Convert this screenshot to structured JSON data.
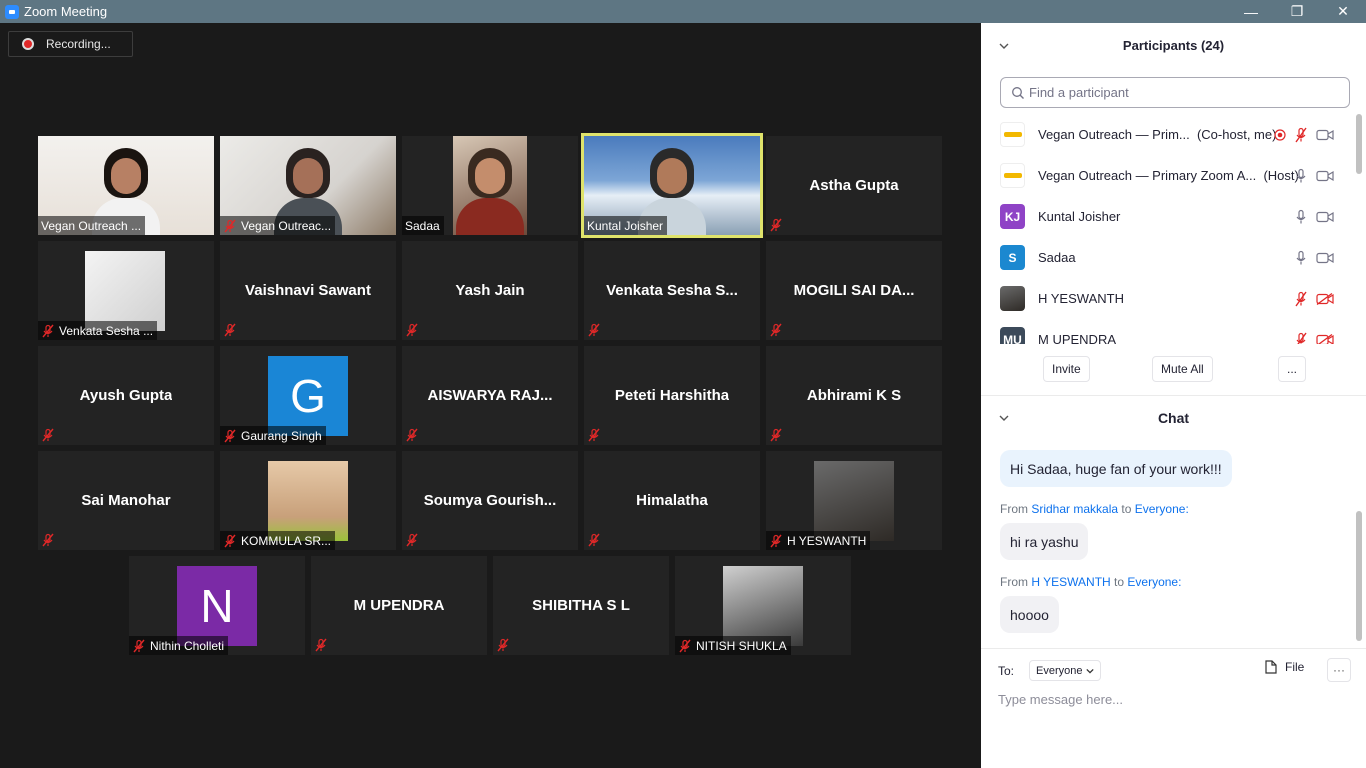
{
  "window": {
    "title": "Zoom Meeting",
    "minimize": "—",
    "restore": "❐",
    "close": "✕"
  },
  "recording": {
    "label": "Recording..."
  },
  "tiles": [
    {
      "label": "Vegan Outreach ...",
      "kind": "video",
      "muted": false
    },
    {
      "label": "Vegan Outreac...",
      "kind": "video",
      "muted": true
    },
    {
      "label": "Sadaa",
      "kind": "video",
      "muted": false
    },
    {
      "label": "Kuntal Joisher",
      "kind": "video",
      "muted": false,
      "active": true
    },
    {
      "name": "Astha Gupta",
      "kind": "name",
      "muted": true
    },
    {
      "label": "Venkata Sesha ...",
      "kind": "picture",
      "muted": true
    },
    {
      "name": "Vaishnavi Sawant",
      "kind": "name",
      "muted": true
    },
    {
      "name": "Yash Jain",
      "kind": "name",
      "muted": true
    },
    {
      "name": "Venkata  Sesha  S...",
      "kind": "name",
      "muted": true
    },
    {
      "name": "MOGILI SAI DA...",
      "kind": "name",
      "muted": true
    },
    {
      "name": "Ayush Gupta",
      "kind": "name",
      "muted": true
    },
    {
      "label": "Gaurang Singh",
      "kind": "avatar",
      "letter": "G",
      "color": "#1a86d6",
      "muted": true
    },
    {
      "name": "AISWARYA RAJ...",
      "kind": "name",
      "muted": true
    },
    {
      "name": "Peteti Harshitha",
      "kind": "name",
      "muted": true
    },
    {
      "name": "Abhirami K S",
      "kind": "name",
      "muted": true
    },
    {
      "name": "Sai Manohar",
      "kind": "name",
      "muted": true
    },
    {
      "label": "KOMMULA SR...",
      "kind": "picture",
      "muted": true
    },
    {
      "name": "Soumya  Gourish...",
      "kind": "name",
      "muted": true
    },
    {
      "name": "Himalatha",
      "kind": "name",
      "muted": true
    },
    {
      "label": "H YESWANTH",
      "kind": "picture",
      "muted": true
    },
    {
      "label": "Nithin Cholleti",
      "kind": "avatar",
      "letter": "N",
      "color": "#7b2aa6",
      "muted": true
    },
    {
      "name": "M UPENDRA",
      "kind": "name",
      "muted": true
    },
    {
      "name": "SHIBITHA S L",
      "kind": "name",
      "muted": true
    },
    {
      "label": "NITISH SHUKLA",
      "kind": "picture",
      "muted": true
    }
  ],
  "participants": {
    "title": "Participants (24)",
    "search_placeholder": "Find a participant",
    "items": [
      {
        "name": "Vegan Outreach — Prim...",
        "role": "(Co-host, me)",
        "avatar": "logo",
        "recording": true,
        "mic": "muted",
        "video": "on"
      },
      {
        "name": "Vegan Outreach — Primary Zoom A...",
        "role": "(Host)",
        "avatar": "logo",
        "mic": "on",
        "video": "on"
      },
      {
        "name": "Kuntal Joisher",
        "avatar_text": "KJ",
        "avatar_color": "#8f43c6",
        "mic": "on",
        "video": "on"
      },
      {
        "name": "Sadaa",
        "avatar_text": "S",
        "avatar_color": "#1b88d0",
        "mic": "on",
        "video": "on"
      },
      {
        "name": "H YESWANTH",
        "avatar": "photo",
        "mic": "muted",
        "video": "off"
      },
      {
        "name": "M UPENDRA",
        "avatar_text": "MU",
        "avatar_color": "#3c4a5a",
        "mic": "muted",
        "video": "off"
      }
    ],
    "buttons": {
      "invite": "Invite",
      "mute_all": "Mute All",
      "more": "..."
    }
  },
  "chat": {
    "title": "Chat",
    "messages": [
      {
        "text": "Hi Sadaa, huge fan of your work!!!"
      },
      {
        "from_prefix": "From",
        "from": "Sridhar makkala",
        "to_word": "to",
        "to": "Everyone:",
        "text": "hi ra yashu"
      },
      {
        "from_prefix": "From",
        "from": "H YESWANTH",
        "to_word": "to",
        "to": "Everyone:",
        "text": "hoooo"
      }
    ],
    "to_label": "To:",
    "to_value": "Everyone",
    "file_label": "File",
    "more_label": "···",
    "input_placeholder": "Type message here..."
  }
}
